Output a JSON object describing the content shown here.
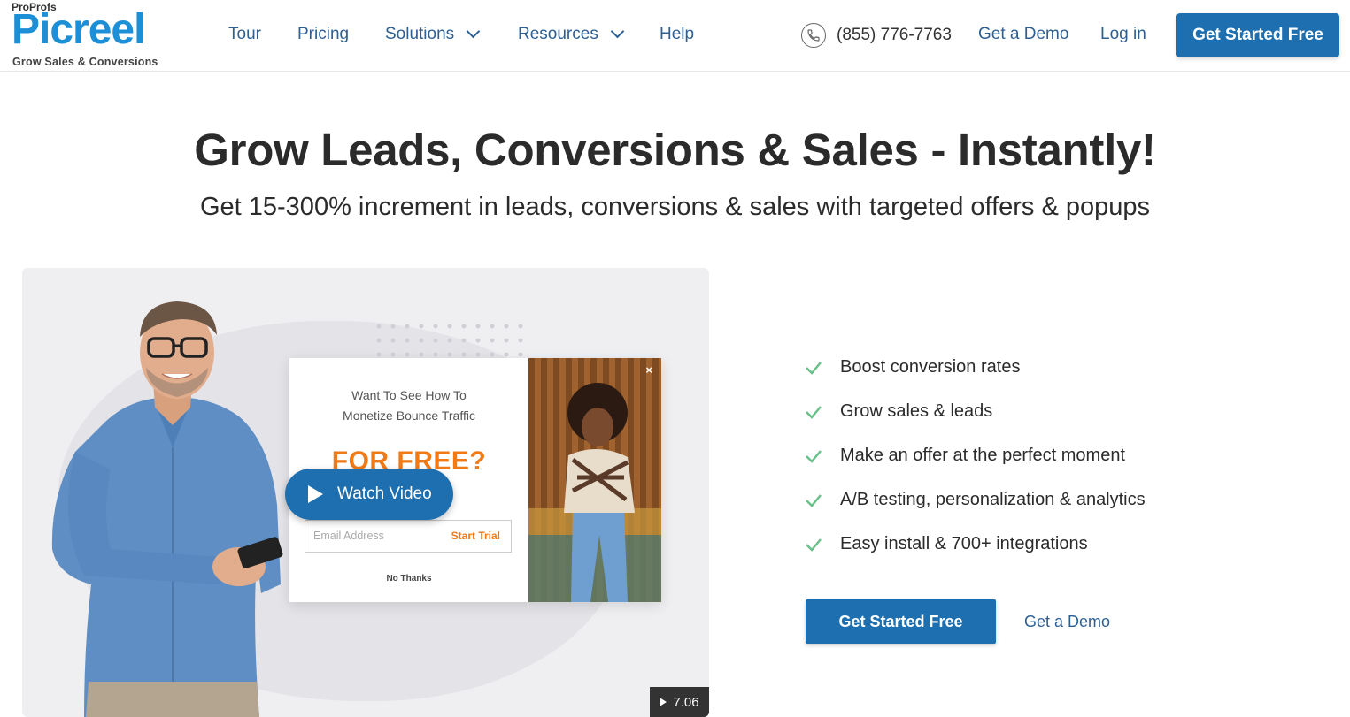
{
  "brand": {
    "company": "ProProfs",
    "product": "Picreel",
    "tagline": "Grow Sales & Conversions",
    "color": "#1d8fd6"
  },
  "nav": {
    "items": [
      {
        "label": "Tour"
      },
      {
        "label": "Pricing"
      },
      {
        "label": "Solutions"
      },
      {
        "label": "Resources"
      },
      {
        "label": "Help"
      }
    ],
    "phone": "(855) 776-7763",
    "demo_label": "Get a Demo",
    "login_label": "Log in",
    "cta_label": "Get Started Free"
  },
  "hero": {
    "title": "Grow Leads, Conversions & Sales - Instantly!",
    "subtitle": "Get 15-300% increment in leads, conversions & sales with targeted offers & popups"
  },
  "video": {
    "popup": {
      "line1": "Want To See How To",
      "line2": "Monetize Bounce Traffic",
      "headline": "FOR FREE?",
      "email_placeholder": "Email Address",
      "trial_button": "Start Trial",
      "decline": "No Thanks",
      "close": "×"
    },
    "watch_label": "Watch Video",
    "duration": "7.06"
  },
  "features": [
    "Boost conversion rates",
    "Grow sales & leads",
    "Make an offer at the perfect moment",
    "A/B testing, personalization & analytics",
    "Easy install & 700+ integrations"
  ],
  "cta": {
    "primary": "Get Started Free",
    "secondary": "Get a Demo"
  },
  "colors": {
    "accent": "#1d6fb0",
    "link": "#2d5f93",
    "check": "#6cc08b",
    "offer": "#f07a18"
  }
}
